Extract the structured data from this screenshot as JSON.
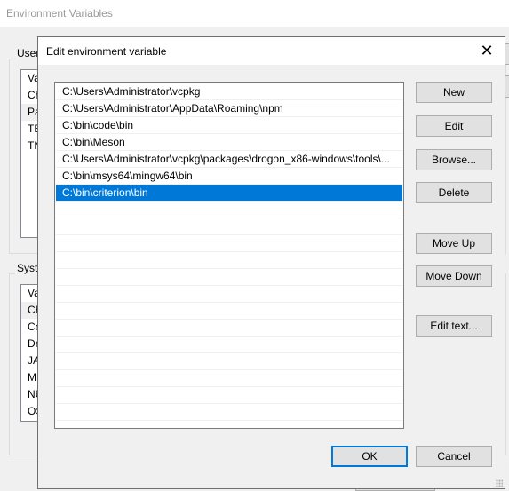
{
  "background_window": {
    "title": "Environment Variables",
    "user_group_label": "User",
    "user_list": [
      "Va",
      "Ch",
      "Pa",
      "TE",
      "TN"
    ],
    "system_group_label": "Syste",
    "system_list": [
      "Va",
      "CH",
      "Co",
      "Dr",
      "JA",
      "M",
      "NU",
      "OS"
    ]
  },
  "dialog": {
    "title": "Edit environment variable",
    "close_icon": "close-icon",
    "paths": [
      "C:\\Users\\Administrator\\vcpkg",
      "C:\\Users\\Administrator\\AppData\\Roaming\\npm",
      "C:\\bin\\code\\bin",
      "C:\\bin\\Meson",
      "C:\\Users\\Administrator\\vcpkg\\packages\\drogon_x86-windows\\tools\\...",
      "C:\\bin\\msys64\\mingw64\\bin",
      "C:\\bin\\criterion\\bin"
    ],
    "selected_index": 6,
    "buttons": {
      "new": "New",
      "edit": "Edit",
      "browse": "Browse...",
      "delete": "Delete",
      "move_up": "Move Up",
      "move_down": "Move Down",
      "edit_text": "Edit text...",
      "ok": "OK",
      "cancel": "Cancel"
    },
    "colors": {
      "selection": "#0078d7",
      "focus_border": "#0078d7"
    }
  }
}
